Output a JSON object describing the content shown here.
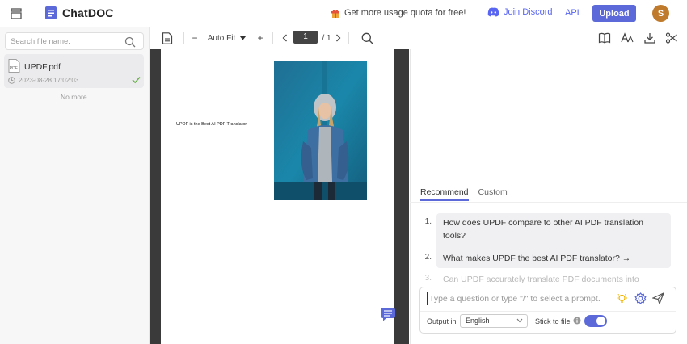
{
  "header": {
    "brand": "ChatDOC",
    "promo_text": "Get more usage quota for free!",
    "discord_label": "Join Discord",
    "api_label": "API",
    "upload_label": "Upload",
    "avatar_initial": "S",
    "accent_color": "#5b6ad8"
  },
  "sidebar": {
    "search_placeholder": "Search file name.",
    "files": [
      {
        "name": "UPDF.pdf",
        "date": "2023-08-28 17:02:03",
        "status_icon": "check-icon"
      }
    ],
    "end_text": "No more."
  },
  "pdf_toolbar": {
    "zoom_minus": "−",
    "zoom_label": "Auto Fit",
    "zoom_plus": "+",
    "page_current": "1",
    "page_total": "/ 1"
  },
  "pdf": {
    "text_line": "UPDF is the Best AI PDF Translator"
  },
  "chat": {
    "tabs": [
      {
        "label": "Recommend",
        "active": true
      },
      {
        "label": "Custom",
        "active": false
      }
    ],
    "suggestions": [
      {
        "num": "1.",
        "text_line1": "How does UPDF compare to other AI PDF translation tools?",
        "text_line2": "→"
      },
      {
        "num": "2.",
        "text_line1": "What makes UPDF the best AI PDF translator? →"
      },
      {
        "num": "3.",
        "text_line1": "Can UPDF accurately translate PDF documents into"
      }
    ],
    "input_placeholder": "Type a question or type \"/\" to select a prompt.",
    "output_label": "Output in",
    "output_language": "English",
    "stick_label": "Stick to file",
    "stick_enabled": true
  }
}
